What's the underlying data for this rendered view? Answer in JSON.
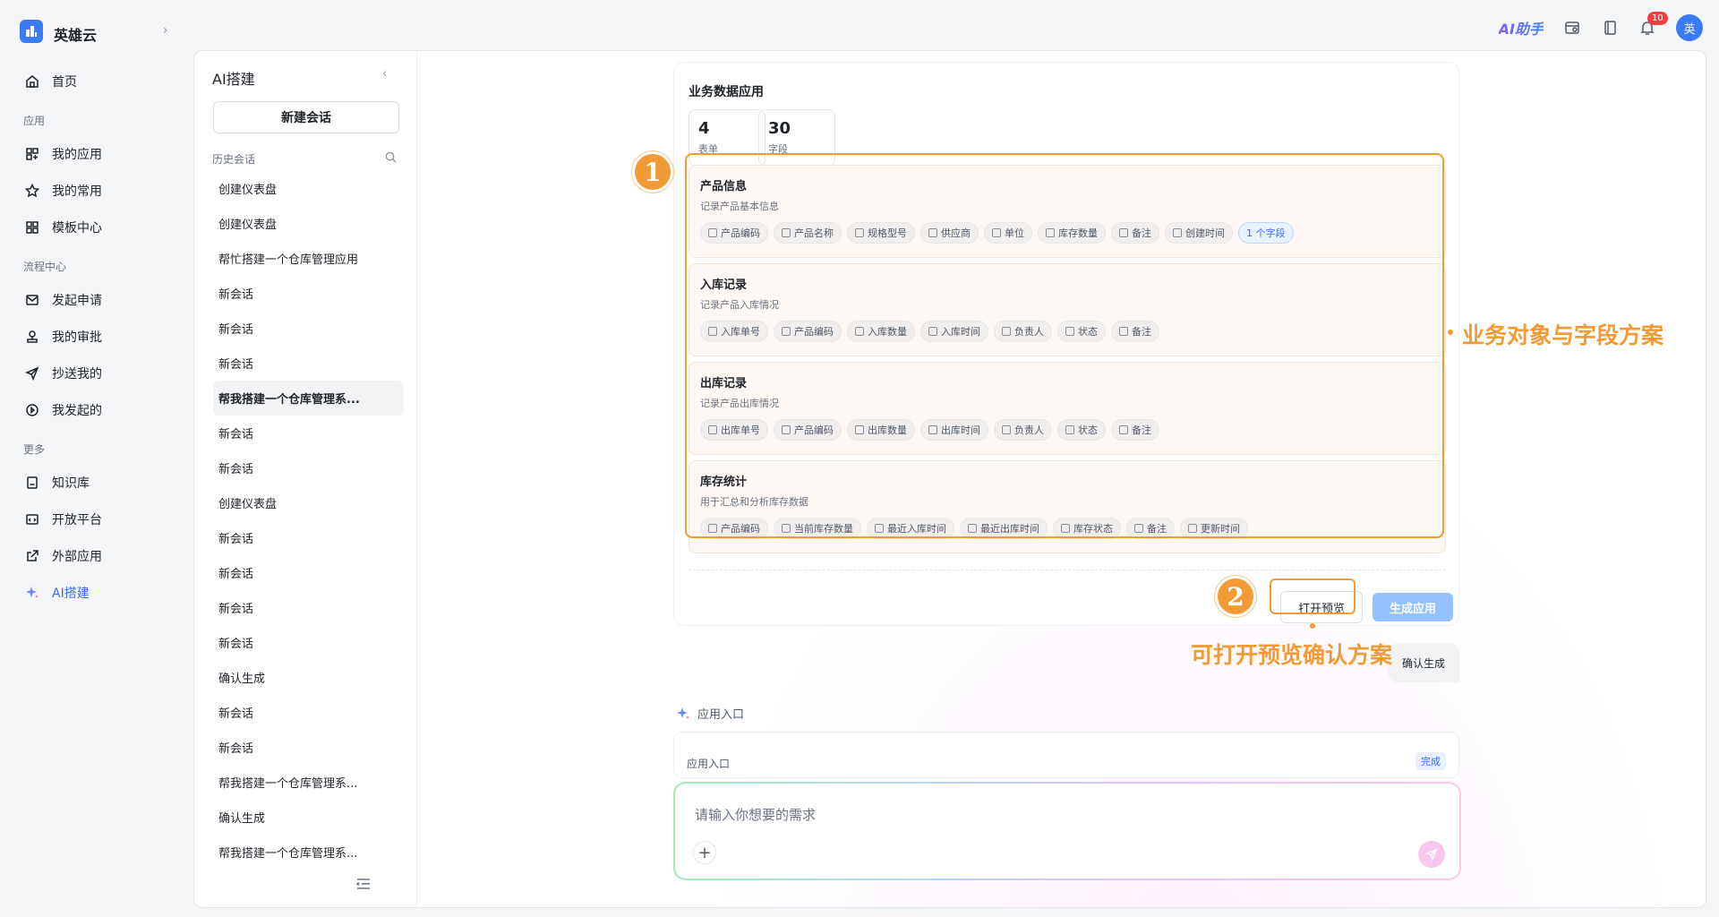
{
  "app": {
    "name": "英雄云"
  },
  "topbar": {
    "ai_helper": "AI助手",
    "notification_count": "10",
    "avatar": "英"
  },
  "nav": {
    "home": "首页",
    "section_apps": "应用",
    "my_apps": "我的应用",
    "my_common": "我的常用",
    "templates": "模板中心",
    "section_flow": "流程中心",
    "start_request": "发起申请",
    "my_approval": "我的审批",
    "cc_me": "抄送我的",
    "my_started": "我发起的",
    "section_more": "更多",
    "knowledge": "知识库",
    "open_platform": "开放平台",
    "external_apps": "外部应用",
    "ai_build": "AI搭建"
  },
  "conversations": {
    "title": "AI搭建",
    "new_chat": "新建会话",
    "history_label": "历史会话",
    "items": [
      "创建仪表盘",
      "创建仪表盘",
      "帮忙搭建一个仓库管理应用",
      "新会话",
      "新会话",
      "新会话",
      "帮我搭建一个仓库管理系...",
      "新会话",
      "新会话",
      "创建仪表盘",
      "新会话",
      "新会话",
      "新会话",
      "新会话",
      "确认生成",
      "新会话",
      "新会话",
      "帮我搭建一个仓库管理系...",
      "确认生成",
      "帮我搭建一个仓库管理系..."
    ],
    "selected_index": 6
  },
  "app_card": {
    "title": "业务数据应用",
    "stats": [
      {
        "num": "4",
        "label": "表单"
      },
      {
        "num": "30",
        "label": "字段"
      }
    ],
    "objects": [
      {
        "name": "产品信息",
        "desc": "记录产品基本信息",
        "fields": [
          "产品编码",
          "产品名称",
          "规格型号",
          "供应商",
          "单位",
          "库存数量",
          "备注",
          "创建时间"
        ],
        "more": "1 个字段"
      },
      {
        "name": "入库记录",
        "desc": "记录产品入库情况",
        "fields": [
          "入库单号",
          "产品编码",
          "入库数量",
          "入库时间",
          "负责人",
          "状态",
          "备注"
        ]
      },
      {
        "name": "出库记录",
        "desc": "记录产品出库情况",
        "fields": [
          "出库单号",
          "产品编码",
          "出库数量",
          "出库时间",
          "负责人",
          "状态",
          "备注"
        ]
      },
      {
        "name": "库存统计",
        "desc": "用于汇总和分析库存数据",
        "fields": [
          "产品编码",
          "当前库存数量",
          "最近入库时间",
          "最近出库时间",
          "库存状态",
          "备注",
          "更新时间"
        ]
      }
    ],
    "preview_button": "打开预览",
    "generate_button": "生成应用"
  },
  "confirm_bubble": "确认生成",
  "entry": {
    "head": "应用入口",
    "label": "应用入口",
    "status": "完成"
  },
  "input": {
    "placeholder": "请输入你想要的需求"
  },
  "annotations": {
    "num1": "1",
    "num2": "2",
    "text1": "业务对象与字段方案",
    "text2": "可打开预览确认方案"
  },
  "colors": {
    "accent": "#3b6cf6",
    "annotation": "#f29a34"
  }
}
